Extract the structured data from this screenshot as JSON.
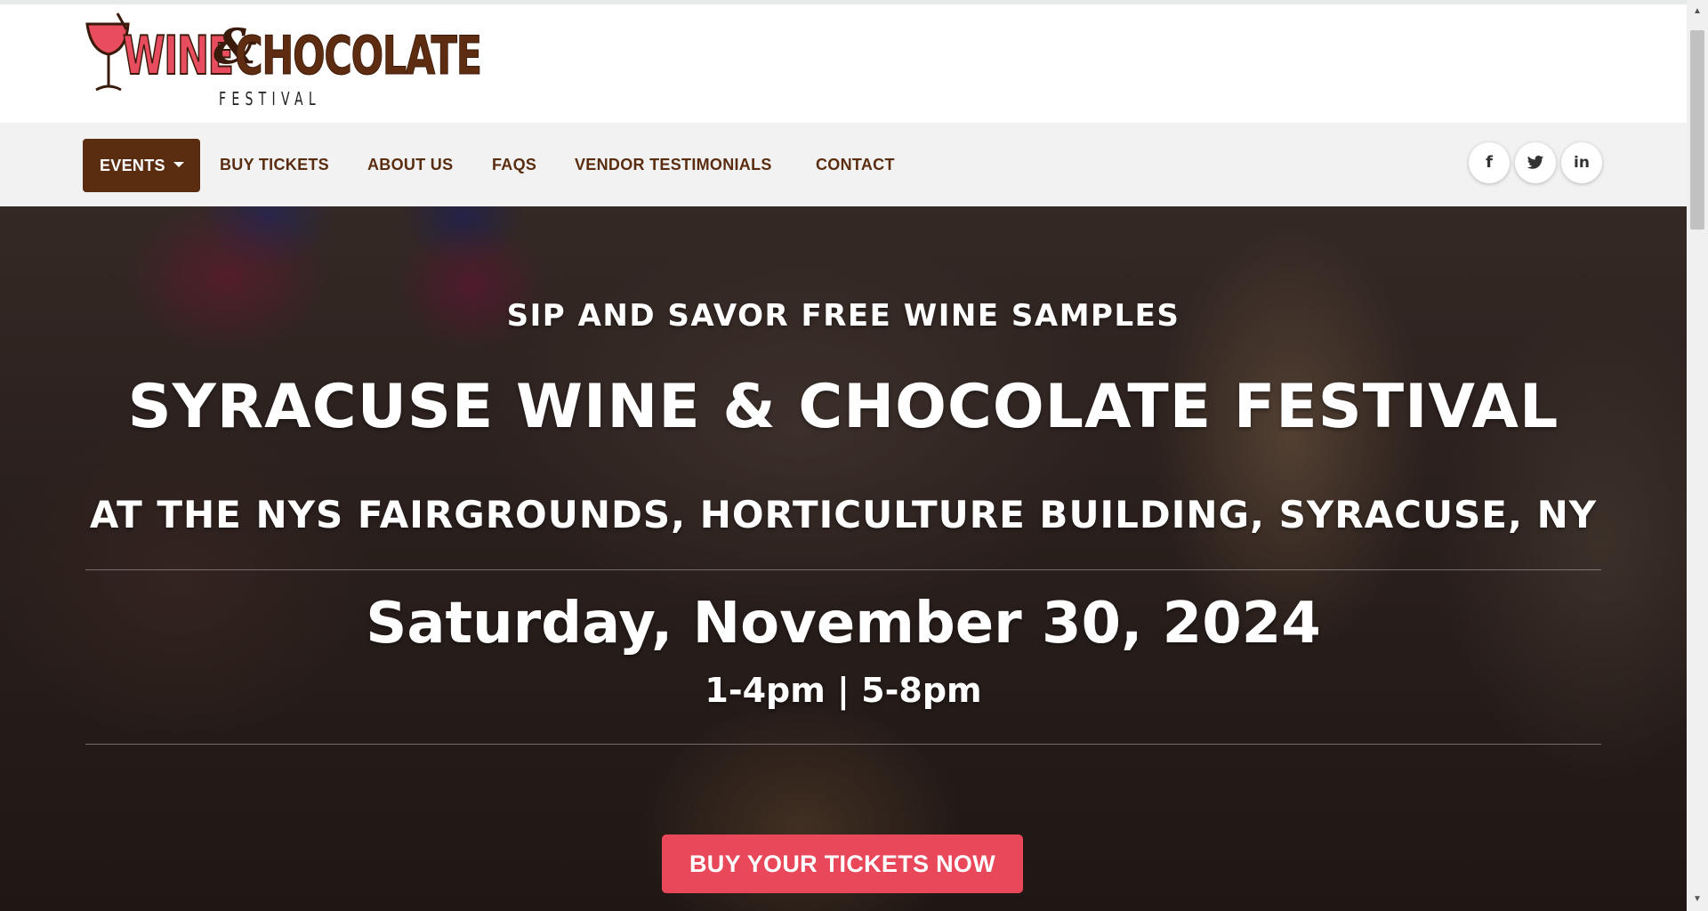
{
  "logo": {
    "word1": "WINE",
    "amp": "&",
    "word2": "CHOCOLATE",
    "sub": "FESTIVAL"
  },
  "nav": {
    "items": [
      {
        "label": "EVENTS",
        "active": true
      },
      {
        "label": "BUY TICKETS"
      },
      {
        "label": "ABOUT US"
      },
      {
        "label": "FAQS"
      },
      {
        "label": "VENDOR TESTIMONIALS"
      },
      {
        "label": "CONTACT"
      }
    ],
    "social": [
      {
        "icon": "facebook-icon",
        "glyph": "f"
      },
      {
        "icon": "twitter-icon",
        "glyph": "🐦"
      },
      {
        "icon": "linkedin-icon",
        "glyph": "in"
      }
    ]
  },
  "hero": {
    "kicker": "SIP AND SAVOR FREE WINE SAMPLES",
    "title": "SYRACUSE WINE & CHOCOLATE FESTIVAL",
    "venue": "AT THE NYS FAIRGROUNDS, HORTICULTURE BUILDING, SYRACUSE, NY",
    "date": "Saturday, November 30, 2024",
    "time": "1-4pm | 5-8pm",
    "cta": "BUY YOUR TICKETS NOW"
  },
  "colors": {
    "brand_brown": "#5a2d10",
    "brand_red": "#e8485a",
    "nav_bg": "#f2f2f2"
  }
}
